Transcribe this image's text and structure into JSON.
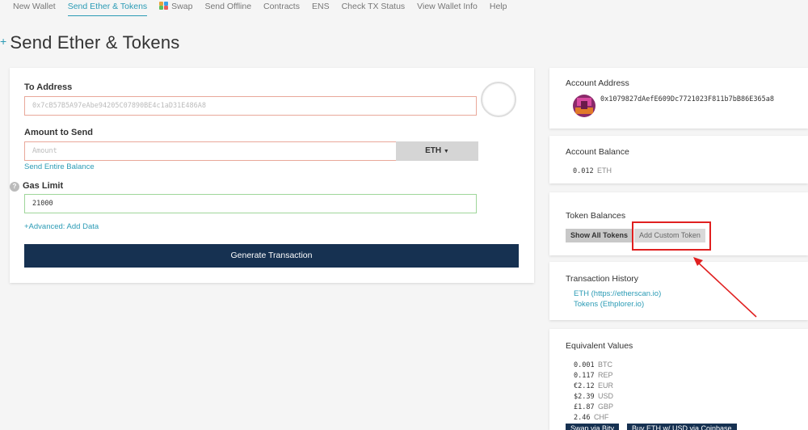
{
  "nav": {
    "items": [
      {
        "label": "New Wallet"
      },
      {
        "label": "Send Ether & Tokens"
      },
      {
        "label": "Swap"
      },
      {
        "label": "Send Offline"
      },
      {
        "label": "Contracts"
      },
      {
        "label": "ENS"
      },
      {
        "label": "Check TX Status"
      },
      {
        "label": "View Wallet Info"
      },
      {
        "label": "Help"
      }
    ],
    "active": "Send Ether & Tokens",
    "swap_icon": "swap-icon"
  },
  "page": {
    "title": "Send Ether & Tokens"
  },
  "send_form": {
    "to_address_label": "To Address",
    "to_address_placeholder": "0x7cB57B5A97eAbe94205C07890BE4c1aD31E486A8",
    "amount_label": "Amount to Send",
    "amount_placeholder": "Amount",
    "unit_label": "ETH",
    "send_entire_balance": "Send Entire Balance",
    "gas_limit_label": "Gas Limit",
    "gas_limit_value": "21000",
    "advanced_link": "+Advanced: Add Data",
    "generate_button": "Generate Transaction",
    "help_icon": "question-icon"
  },
  "account": {
    "address_title": "Account Address",
    "address": "0x1079827dAefE609Dc7721023F811b7bB86E365a8",
    "balance_title": "Account Balance",
    "balance_value": "0.012",
    "balance_unit": "ETH"
  },
  "tokens": {
    "title": "Token Balances",
    "show_all_button": "Show All Tokens",
    "add_custom_button": "Add Custom Token"
  },
  "history": {
    "title": "Transaction History",
    "links": [
      "ETH (https://etherscan.io)",
      "Tokens (Ethplorer.io)"
    ]
  },
  "equivalent": {
    "title": "Equivalent Values",
    "rows": [
      {
        "value": "0.001",
        "unit": "BTC"
      },
      {
        "value": "0.117",
        "unit": "REP"
      },
      {
        "value": "€2.12",
        "unit": "EUR"
      },
      {
        "value": "$2.39",
        "unit": "USD"
      },
      {
        "value": "£1.87",
        "unit": "GBP"
      },
      {
        "value": "2.46",
        "unit": "CHF"
      }
    ],
    "buttons": [
      "Swap via Bity",
      "Buy ETH w/ USD via Coinbase"
    ]
  },
  "colors": {
    "accent": "#2b9bb5",
    "primary_button": "#163151",
    "annotation": "#e02020"
  }
}
